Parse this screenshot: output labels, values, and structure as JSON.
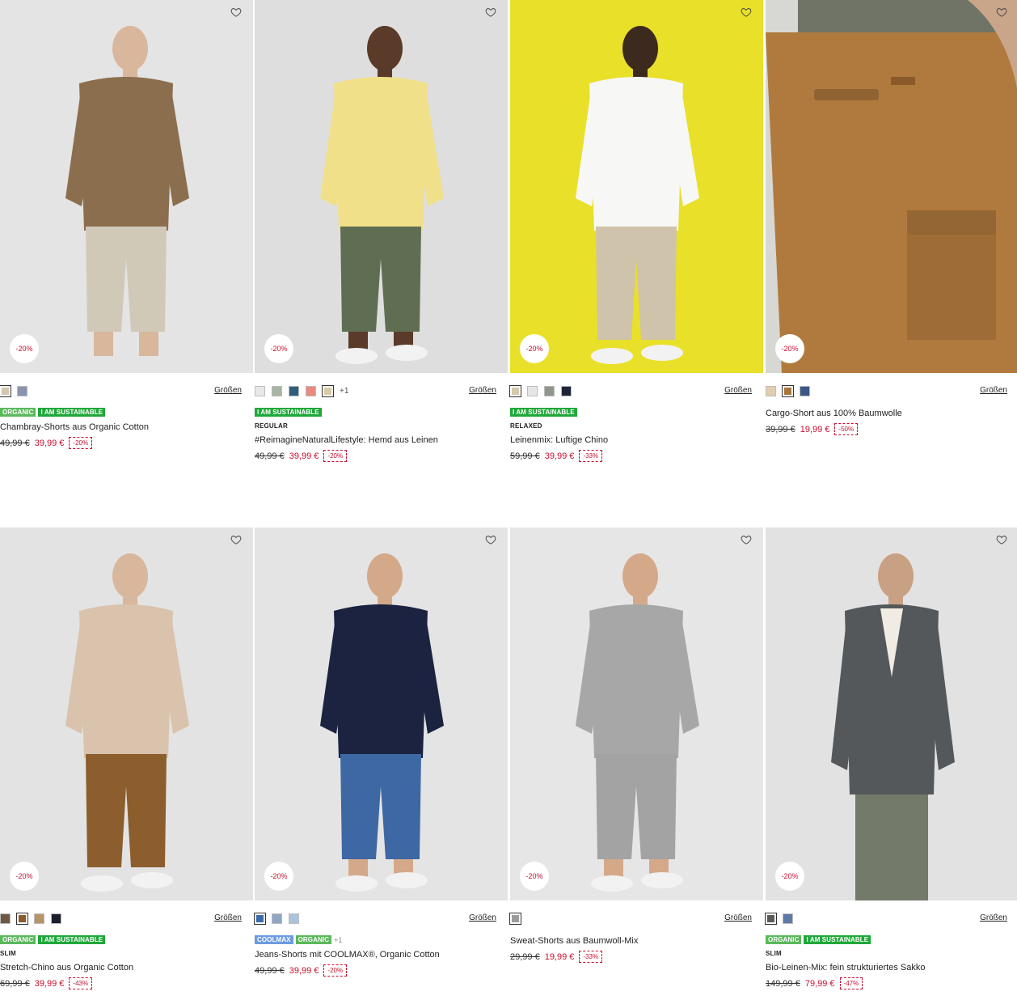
{
  "ui": {
    "sizes_label": "Größen"
  },
  "products": [
    {
      "badge": "-20%",
      "swatches": [
        "#d4c6b0",
        "#8a93ad"
      ],
      "swatch_selected": 0,
      "more_colors": "",
      "tags": [
        {
          "label": "ORGANIC",
          "kind": "organic"
        },
        {
          "label": "I AM SUSTAINABLE",
          "kind": "sust"
        }
      ],
      "tags_more": "",
      "fit": "",
      "name": "Chambray-Shorts aus Organic Cotton",
      "old_price": "49,99 €",
      "new_price": "39,99 €",
      "discount": "-20%",
      "photo": {
        "bg": "#e4e4e4",
        "top": "#8b6e4e",
        "bottom": "#d1c9b8",
        "skin": "#d8b79c",
        "shoes": "",
        "kind": "shorts-shirt"
      }
    },
    {
      "badge": "-20%",
      "swatches": [
        "#e8e8e8",
        "#a8b5a2",
        "#2f5f7a",
        "#e88a80",
        "#d8cca8"
      ],
      "swatch_selected": 4,
      "more_colors": "+1",
      "tags": [
        {
          "label": "I AM SUSTAINABLE",
          "kind": "sust"
        }
      ],
      "tags_more": "",
      "fit": "REGULAR",
      "name": "#ReimagineNaturalLifestyle: Hemd aus Leinen",
      "old_price": "49,99 €",
      "new_price": "39,99 €",
      "discount": "-20%",
      "photo": {
        "bg": "#dedede",
        "top": "#f1e08a",
        "bottom": "#5f6e52",
        "skin": "#5a3a28",
        "shoes": "#f2f2f2",
        "kind": "shorts-shirt"
      }
    },
    {
      "badge": "-20%",
      "swatches": [
        "#d6c7ad",
        "#e6e6e6",
        "#8e978a",
        "#1d2435"
      ],
      "swatch_selected": 0,
      "more_colors": "",
      "tags": [
        {
          "label": "I AM SUSTAINABLE",
          "kind": "sust"
        }
      ],
      "tags_more": "",
      "fit": "RELAXED",
      "name": "Leinenmix: Luftige Chino",
      "old_price": "59,99 €",
      "new_price": "39,99 €",
      "discount": "-33%",
      "photo": {
        "bg": "#e9e02a",
        "top": "#f7f7f5",
        "bottom": "#cfc3ab",
        "skin": "#3d2a1e",
        "shoes": "#f2f2f2",
        "kind": "pants-shirt"
      }
    },
    {
      "badge": "-20%",
      "swatches": [
        "#e2cdb1",
        "#a8763d",
        "#3b5687"
      ],
      "swatch_selected": 1,
      "more_colors": "",
      "tags": [],
      "tags_more": "",
      "fit": "",
      "name": "Cargo-Short aus 100% Baumwolle",
      "old_price": "39,99 €",
      "new_price": "19,99 €",
      "discount": "-50%",
      "photo": {
        "bg": "#d7d7d3",
        "top": "#6f7467",
        "bottom": "#b07a3e",
        "skin": "#c9a58a",
        "shoes": "",
        "kind": "closeup"
      }
    },
    {
      "badge": "-20%",
      "swatches": [
        "#6c5a44",
        "#8a5a2e",
        "#b59468",
        "#1a1f2b"
      ],
      "swatch_selected": 1,
      "more_colors": "",
      "tags": [
        {
          "label": "ORGANIC",
          "kind": "organic"
        },
        {
          "label": "I AM SUSTAINABLE",
          "kind": "sust"
        }
      ],
      "tags_more": "",
      "fit": "SLIM",
      "name": "Stretch-Chino aus Organic Cotton",
      "old_price": "69,99 €",
      "new_price": "39,99 €",
      "discount": "-43%",
      "photo": {
        "bg": "#e3e3e3",
        "top": "#d9c3ad",
        "bottom": "#8c5d2d",
        "skin": "#d8b79c",
        "shoes": "#f2f2f2",
        "kind": "pants-sweater"
      }
    },
    {
      "badge": "-20%",
      "swatches": [
        "#3b6aa8",
        "#8fa6c2",
        "#a9c4dc"
      ],
      "swatch_selected": 0,
      "more_colors": "",
      "tags": [
        {
          "label": "COOLMAX",
          "kind": "coolmax"
        },
        {
          "label": "ORGANIC",
          "kind": "organic"
        }
      ],
      "tags_more": "+1",
      "fit": "",
      "name": "Jeans-Shorts mit COOLMAX®, Organic Cotton",
      "old_price": "49,99 €",
      "new_price": "39,99 €",
      "discount": "-20%",
      "photo": {
        "bg": "#e4e4e4",
        "top": "#1b2340",
        "bottom": "#3d68a3",
        "skin": "#d4a98a",
        "shoes": "#f2f2f2",
        "kind": "shorts-tee"
      }
    },
    {
      "badge": "-20%",
      "swatches": [
        "#9c9c9c"
      ],
      "swatch_selected": 0,
      "more_colors": "",
      "tags": [],
      "tags_more": "",
      "fit": "",
      "name": "Sweat-Shorts aus Baumwoll-Mix",
      "old_price": "29,99 €",
      "new_price": "19,99 €",
      "discount": "-33%",
      "photo": {
        "bg": "#e6e6e6",
        "top": "#a7a7a7",
        "bottom": "#a3a3a3",
        "skin": "#d4a98a",
        "shoes": "#f2f2f2",
        "kind": "shorts-sweat"
      }
    },
    {
      "badge": "-20%",
      "swatches": [
        "#5a5a5a",
        "#5f7aa8"
      ],
      "swatch_selected": 0,
      "more_colors": "",
      "tags": [
        {
          "label": "ORGANIC",
          "kind": "organic"
        },
        {
          "label": "I AM SUSTAINABLE",
          "kind": "sust"
        }
      ],
      "tags_more": "",
      "fit": "SLIM",
      "name": "Bio-Leinen-Mix: fein strukturiertes Sakko",
      "old_price": "149,99 €",
      "new_price": "79,99 €",
      "discount": "-47%",
      "photo": {
        "bg": "#e2e2e2",
        "top": "#55585a",
        "bottom": "#737a6a",
        "skin": "#c8a083",
        "shoes": "",
        "kind": "blazer"
      }
    }
  ]
}
